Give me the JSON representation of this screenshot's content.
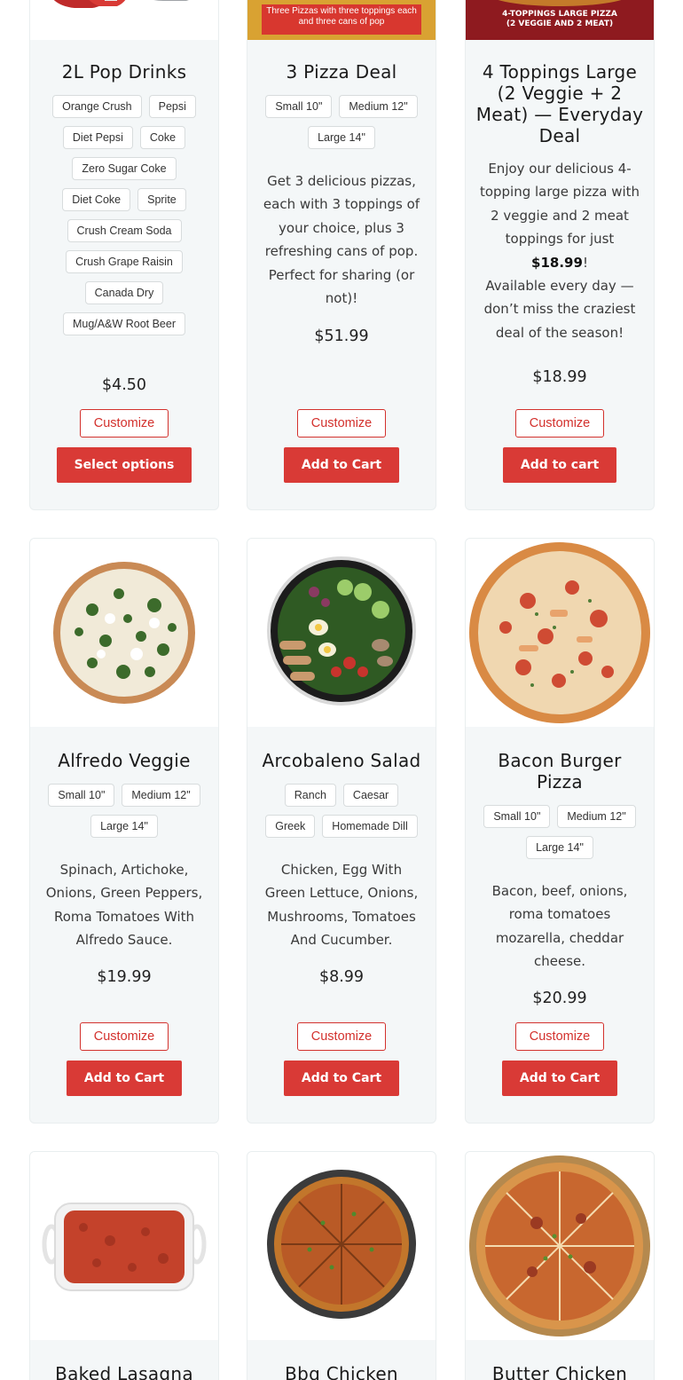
{
  "colors": {
    "accent": "#d93a36",
    "card_bg": "#f4f7f8",
    "text": "#333333"
  },
  "products": [
    {
      "title": "2L Pop Drinks",
      "image": "soda-bottles-image",
      "options": [
        "Orange Crush",
        "Pepsi",
        "Diet Pepsi",
        "Coke",
        "Zero Sugar Coke",
        "Diet Coke",
        "Sprite",
        "Crush Cream Soda",
        "Crush Grape Raisin",
        "Canada Dry",
        "Mug/A&W Root Beer"
      ],
      "price": "$4.50",
      "customize": "Customize",
      "action": "Select options"
    },
    {
      "title": "3 Pizza Deal",
      "image": "pizza-deal-banner-image",
      "banner_text": "Three Pizzas with three toppings each and three cans of pop",
      "options": [
        "Small 10\"",
        "Medium 12\"",
        "Large 14\""
      ],
      "description": "Get 3 delicious pizzas, each with 3 toppings of your choice, plus 3 refreshing cans of pop. Perfect for sharing (or not)!",
      "price": "$51.99",
      "customize": "Customize",
      "action": "Add to Cart"
    },
    {
      "title": "4 Toppings Large (2 Veggie + 2 Meat) — Everyday Deal",
      "image": "four-toppings-banner-image",
      "banner_text_1": "4-TOPPINGS LARGE PIZZA",
      "banner_text_2": "(2 VEGGIE AND 2 MEAT)",
      "description_1": "Enjoy our delicious 4-topping large pizza with 2 veggie and 2 meat toppings for just",
      "description_bold": "$18.99",
      "description_2": "!",
      "description_3": "Available every day — don’t miss the craziest deal of the season!",
      "price": "$18.99",
      "customize": "Customize",
      "action": "Add to cart"
    },
    {
      "title": "Alfredo Veggie",
      "image": "alfredo-veggie-pizza-image",
      "options": [
        "Small 10\"",
        "Medium 12\"",
        "Large 14\""
      ],
      "description": "Spinach, Artichoke, Onions, Green Peppers, Roma Tomatoes With Alfredo Sauce.",
      "price": "$19.99",
      "customize": "Customize",
      "action": "Add to Cart"
    },
    {
      "title": "Arcobaleno Salad",
      "image": "arcobaleno-salad-image",
      "options": [
        "Ranch",
        "Caesar",
        "Greek",
        "Homemade Dill"
      ],
      "description": "Chicken, Egg With Green Lettuce, Onions, Mushrooms, Tomatoes And Cucumber.",
      "price": "$8.99",
      "customize": "Customize",
      "action": "Add to Cart"
    },
    {
      "title": "Bacon Burger Pizza",
      "image": "bacon-burger-pizza-image",
      "options": [
        "Small 10\"",
        "Medium 12\"",
        "Large 14\""
      ],
      "description": "Bacon, beef, onions, roma tomatoes mozarella, cheddar cheese.",
      "price": "$20.99",
      "customize": "Customize",
      "action": "Add to Cart"
    },
    {
      "title": "Baked Lasagna",
      "image": "baked-lasagna-image"
    },
    {
      "title": "Bbq Chicken",
      "image": "bbq-chicken-pizza-image"
    },
    {
      "title": "Butter Chicken",
      "image": "butter-chicken-pizza-image"
    }
  ]
}
